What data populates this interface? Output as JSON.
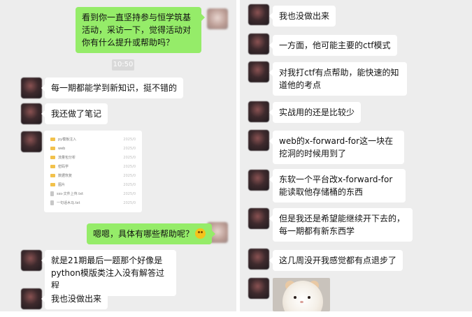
{
  "left_chat": {
    "question_1": "看到你一直坚持参与恒学筑基活动，采访一下，觉得活动对你有什么提升或帮助吗？",
    "time": "10:50",
    "reply_1": "每一期都能学到新知识，挺不错的",
    "reply_2": "我还做了笔记",
    "file_list": [
      {
        "name": "py模板注入",
        "date": "2025/0",
        "type": "folder"
      },
      {
        "name": "web",
        "date": "2025/0",
        "type": "folder"
      },
      {
        "name": "流量包分析",
        "date": "2025/0",
        "type": "folder"
      },
      {
        "name": "密码学",
        "date": "2025/0",
        "type": "folder"
      },
      {
        "name": "数据恢复",
        "date": "2025/0",
        "type": "folder"
      },
      {
        "name": "图片",
        "date": "2025/0",
        "type": "folder"
      },
      {
        "name": "sss-文件上传.txt",
        "date": "2025/0",
        "type": "doc"
      },
      {
        "name": "一句话木马.txt",
        "date": "2025/0",
        "type": "doc"
      }
    ],
    "question_2": "嗯嗯，具体有哪些帮助呢？",
    "reply_3": "就是21期最后一题那个好像是python模版类注入没有解答过程",
    "reply_4": "我也没做出来"
  },
  "right_chat": {
    "msg_1": "我也没做出来",
    "msg_2": "一方面，他可能主要的ctf模式",
    "msg_3": "对我打ctf有点帮助，能快速的知道他的考点",
    "msg_4": "实战用的还是比较少",
    "msg_5": "web的x-forward-for这一块在挖洞的时候用到了",
    "msg_6": "东软一个平台改x-forward-for能读取他存储桶的东西",
    "msg_7": "但是我还是希望能继续开下去的，每一期都有新东西学",
    "msg_8": "这几周没开我感觉都有点退步了"
  },
  "colors": {
    "sent_bubble": "#95ec69",
    "received_bubble": "#ffffff",
    "background": "#ededed"
  },
  "icons": {
    "emoji": "grinning-face-icon",
    "folder": "folder-icon",
    "file": "text-file-icon"
  }
}
